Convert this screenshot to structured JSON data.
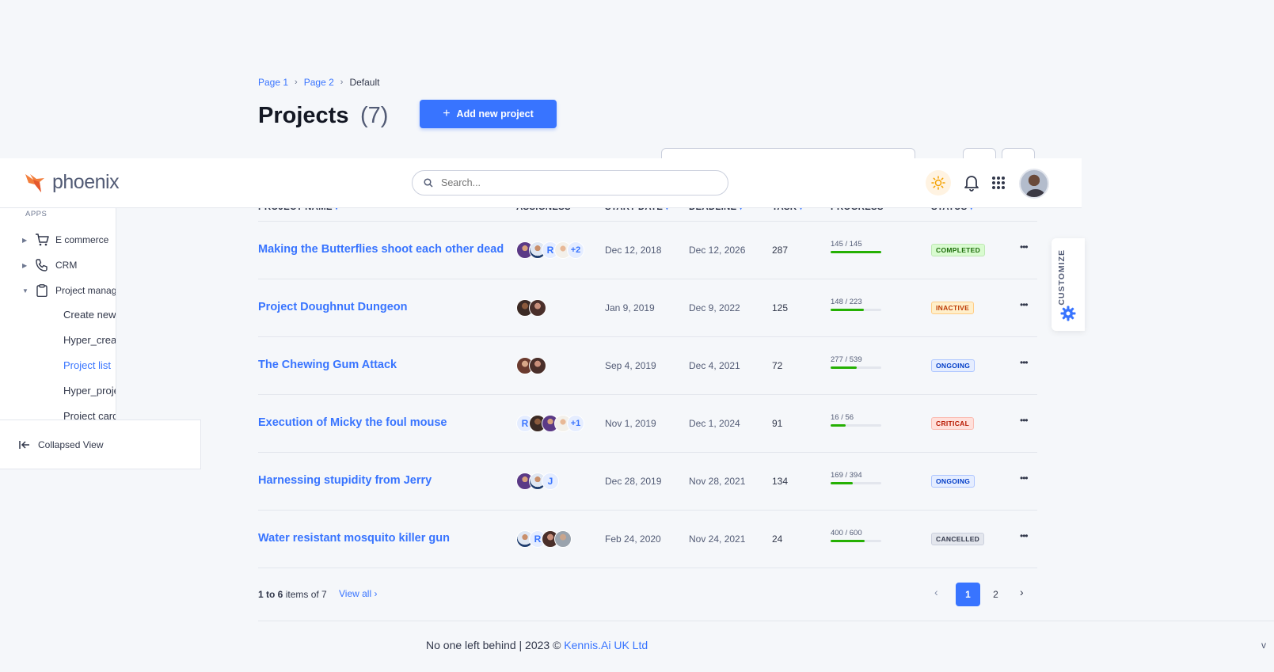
{
  "breadcrumb": {
    "page1": "Page 1",
    "page2": "Page 2",
    "current": "Default"
  },
  "page": {
    "title": "Projects",
    "count": "(7)",
    "add_button": "Add new project"
  },
  "navbar": {
    "logo_text": "phoenix",
    "search_placeholder": "Search..."
  },
  "table_headers": {
    "project_name": "PROJECT NAME",
    "assignees": "ASSIGNESS",
    "start_date": "START DATE",
    "deadline": "DEADLINE",
    "task": "TASK",
    "progress": "PROGRESS",
    "status": "STATUS"
  },
  "sidebar": {
    "section_label": "APPS",
    "items": [
      {
        "label": "E commerce"
      },
      {
        "label": "CRM"
      },
      {
        "label": "Project management"
      }
    ],
    "subitems": [
      {
        "label": "Create new"
      },
      {
        "label": "Hyper_create"
      },
      {
        "label": "Project list"
      },
      {
        "label": "Hyper_project"
      },
      {
        "label": "Project card"
      }
    ],
    "collapse_label": "Collapsed View"
  },
  "projects": [
    {
      "name": "Making the Butterflies shoot each other dead",
      "start": "Dec 12, 2018",
      "deadline": "Dec 12, 2026",
      "task": "287",
      "progress": "145 / 145",
      "progress_fraction": 1.0,
      "status": "COMPLETED",
      "assignee_letter": "R",
      "assignee_more": "+2"
    },
    {
      "name": "Project Doughnut Dungeon",
      "start": "Jan 9, 2019",
      "deadline": "Dec 9, 2022",
      "task": "125",
      "progress": "148 / 223",
      "progress_fraction": 0.66,
      "status": "INACTIVE"
    },
    {
      "name": "The Chewing Gum Attack",
      "start": "Sep 4, 2019",
      "deadline": "Dec 4, 2021",
      "task": "72",
      "progress": "277 / 539",
      "progress_fraction": 0.51,
      "status": "ONGOING"
    },
    {
      "name": "Execution of Micky the foul mouse",
      "start": "Nov 1, 2019",
      "deadline": "Dec 1, 2024",
      "task": "91",
      "progress": "16 / 56",
      "progress_fraction": 0.29,
      "status": "CRITICAL",
      "assignee_letter": "R",
      "assignee_more": "+1"
    },
    {
      "name": "Harnessing stupidity from Jerry",
      "start": "Dec 28, 2019",
      "deadline": "Nov 28, 2021",
      "task": "134",
      "progress": "169 / 394",
      "progress_fraction": 0.43,
      "status": "ONGOING",
      "assignee_letter": "J"
    },
    {
      "name": "Water resistant mosquito killer gun",
      "start": "Feb 24, 2020",
      "deadline": "Nov 24, 2021",
      "task": "24",
      "progress": "400 / 600",
      "progress_fraction": 0.67,
      "status": "CANCELLED",
      "assignee_letter": "R"
    }
  ],
  "table_footer": {
    "range": "1 to 6",
    "items_of": "items of 7",
    "view_all": "View all",
    "pages": [
      "1",
      "2"
    ]
  },
  "footer": {
    "text": "No one left behind | 2023 ©",
    "link": "Kennis.Ai UK Ltd",
    "version": "v"
  },
  "customize": {
    "label": "CUSTOMIZE"
  },
  "colors": {
    "primary": "#3874ff",
    "success": "#25b003",
    "brand_orange": "#f27e3c"
  },
  "icons": [
    "chevron-right-icon",
    "plus-icon",
    "search-icon",
    "sun-icon",
    "bell-icon",
    "grid-icon",
    "cart-icon",
    "phone-icon",
    "clipboard-icon",
    "collapse-icon",
    "more-icon",
    "gear-icon",
    "chevron-left-icon"
  ]
}
